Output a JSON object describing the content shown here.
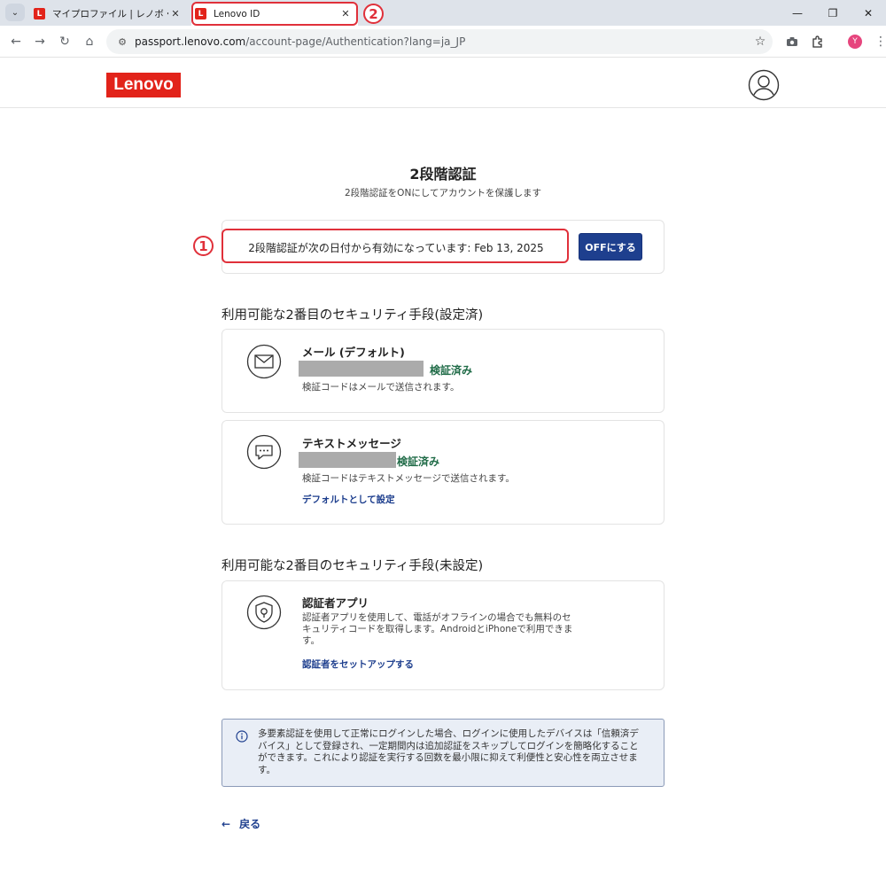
{
  "browser": {
    "tabs": [
      {
        "favicon": "L",
        "title": "マイプロファイル | レノボ・ジャパン"
      },
      {
        "favicon": "L",
        "title": "Lenovo ID"
      }
    ],
    "close_glyph": "✕",
    "url_host": "passport.lenovo.com",
    "url_path": "/account-page/Authentication?lang=ja_JP",
    "profile_initial": "Y"
  },
  "annotations": {
    "marker_1": "1",
    "marker_2": "2"
  },
  "site": {
    "logo": "Lenovo"
  },
  "main": {
    "title": "2段階認証",
    "subtitle": "2段階認証をONにしてアカウントを保護します",
    "status_text": "2段階認証が次の日付から有効になっています: Feb 13, 2025",
    "off_button": "OFFにする"
  },
  "configured": {
    "heading": "利用可能な2番目のセキュリティ手段(設定済)",
    "methods": [
      {
        "name": "メール (デフォルト)",
        "verified": "検証済み",
        "description": "検証コードはメールで送信されます。",
        "icon": "mail-icon"
      },
      {
        "name": "テキストメッセージ",
        "verified": "検証済み",
        "description": "検証コードはテキストメッセージで送信されます。",
        "link": "デフォルトとして設定",
        "icon": "chat-icon"
      }
    ]
  },
  "unconfigured": {
    "heading": "利用可能な2番目のセキュリティ手段(未設定)",
    "methods": [
      {
        "name": "認証者アプリ",
        "description_line1": "認証者アプリを使用して、電話がオフラインの場合でも無料のセ",
        "description_line2": "キュリティコードを取得します。AndroidとiPhoneで利用できま",
        "description_line3": "す。",
        "link": "認証者をセットアップする",
        "icon": "shield-lock-icon"
      }
    ]
  },
  "info": {
    "line1": "多要素認証を使用して正常にログインした場合、ログインに使用したデバイスは「信頼済デ",
    "line2": "バイス」として登録され、一定期間内は追加認証をスキップしてログインを簡略化すること",
    "line3": "ができます。これにより認証を実行する回数を最小限に抑えて利便性と安心性を両立させま",
    "line4": "す。"
  },
  "back": {
    "arrow": "←",
    "label": "戻る"
  }
}
